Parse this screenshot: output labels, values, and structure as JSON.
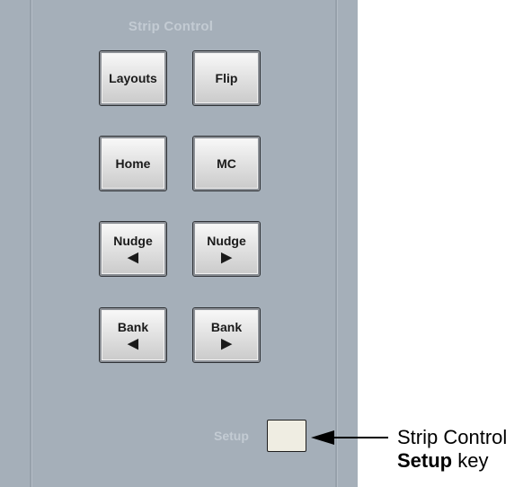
{
  "panel": {
    "title": "Strip Control",
    "keys": [
      {
        "id": "layouts",
        "label": "Layouts",
        "arrow": ""
      },
      {
        "id": "flip",
        "label": "Flip",
        "arrow": ""
      },
      {
        "id": "home",
        "label": "Home",
        "arrow": ""
      },
      {
        "id": "mc",
        "label": "MC",
        "arrow": ""
      },
      {
        "id": "nudge-left",
        "label": "Nudge",
        "arrow": "◀"
      },
      {
        "id": "nudge-right",
        "label": "Nudge",
        "arrow": "▶"
      },
      {
        "id": "bank-left",
        "label": "Bank",
        "arrow": "◀"
      },
      {
        "id": "bank-right",
        "label": "Bank",
        "arrow": "▶"
      }
    ],
    "setup_label": "Setup"
  },
  "callout": {
    "line1": "Strip Control",
    "line2_bold": "Setup",
    "line2_rest": " key"
  },
  "colors": {
    "panel": "#a5afb9",
    "panel_text": "#c3cbd3",
    "setup_key": "#efede2"
  }
}
